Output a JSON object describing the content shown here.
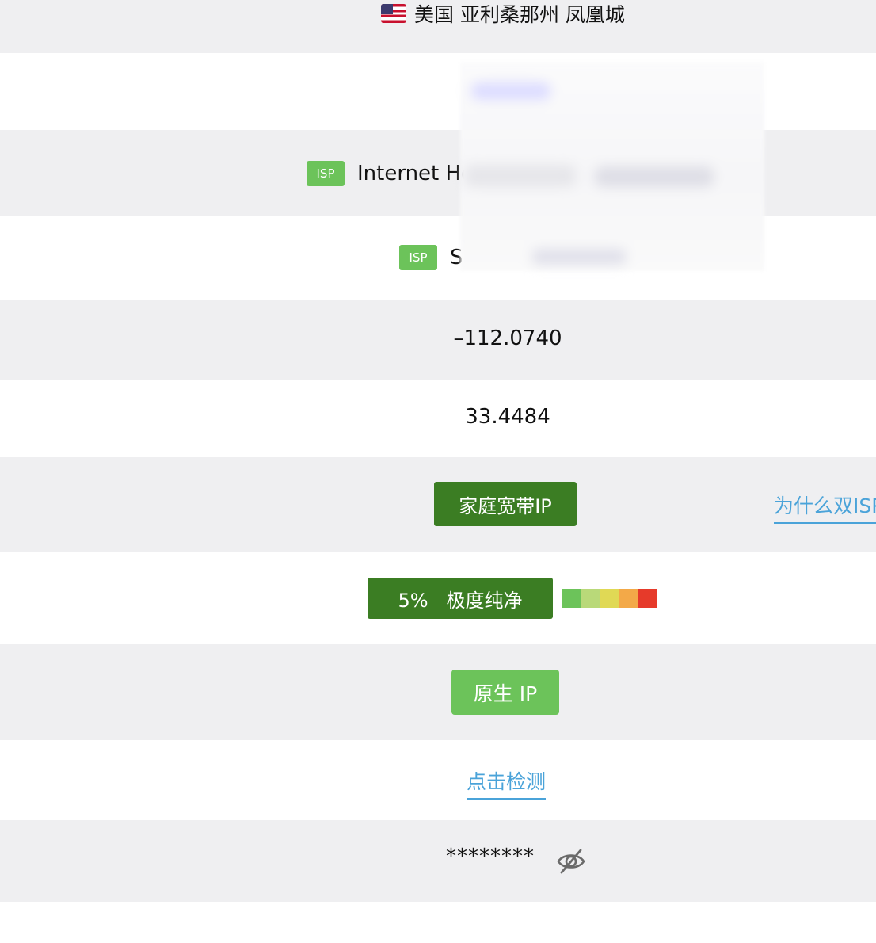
{
  "location": {
    "flag_icon": "us-flag-icon",
    "text": "美国 亚利桑那州 凤凰城"
  },
  "isp_rows": [
    {
      "badge": "ISP",
      "text": "Internet Ho"
    },
    {
      "badge": "ISP",
      "text": "S"
    }
  ],
  "coordinates": {
    "longitude": "–112.0740",
    "latitude": "33.4484"
  },
  "ip_type": {
    "label": "家庭宽带IP",
    "help_link": "为什么双ISP"
  },
  "purity": {
    "label": "5%   极度纯净",
    "scale_colors": [
      "#6cc35a",
      "#b9d979",
      "#e0d955",
      "#f3a948",
      "#e63a2a"
    ]
  },
  "native_ip": {
    "label": "原生 IP"
  },
  "check_link": {
    "label": "点击检测"
  },
  "masked": {
    "value": "********",
    "toggle_icon": "eye-slash-icon"
  },
  "colors": {
    "dark_green": "#3b7d23",
    "light_green": "#6cc35a",
    "link_blue": "#4aa3d9",
    "row_gray": "#efeff1"
  }
}
